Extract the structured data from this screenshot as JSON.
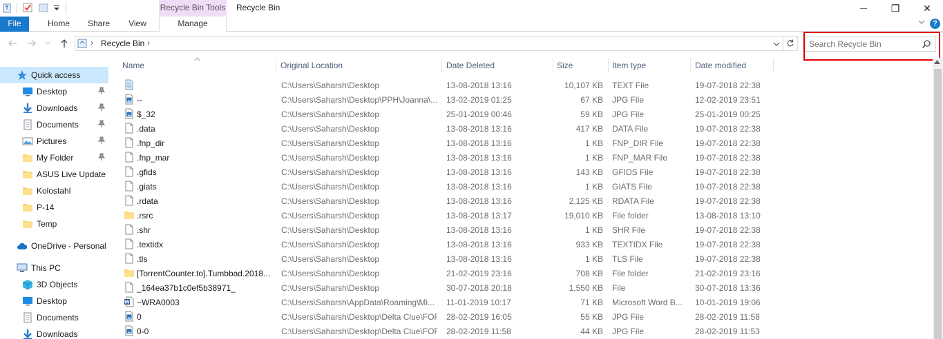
{
  "window": {
    "title": "Recycle Bin",
    "contextual_tab_group": "Recycle Bin Tools",
    "controls": {
      "minimize": "—",
      "maximize": "❐",
      "close": "✕"
    }
  },
  "ribbon": {
    "tabs": [
      "File",
      "Home",
      "Share",
      "View",
      "Manage"
    ],
    "help": "?"
  },
  "address": {
    "breadcrumb_separator": "›",
    "location": "Recycle Bin",
    "trailing_chevron": "›"
  },
  "search": {
    "placeholder": "Search Recycle Bin"
  },
  "nav": {
    "items": [
      {
        "label": "Quick access",
        "icon": "star-icon",
        "pinned": false
      },
      {
        "label": "Desktop",
        "icon": "desktop-icon",
        "pinned": true
      },
      {
        "label": "Downloads",
        "icon": "download-icon",
        "pinned": true
      },
      {
        "label": "Documents",
        "icon": "documents-icon",
        "pinned": true
      },
      {
        "label": "Pictures",
        "icon": "pictures-icon",
        "pinned": true
      },
      {
        "label": "My Folder",
        "icon": "folder-icon",
        "pinned": true
      },
      {
        "label": "ASUS Live Update",
        "icon": "folder-icon",
        "pinned": false
      },
      {
        "label": "Kolostahl",
        "icon": "folder-icon",
        "pinned": false
      },
      {
        "label": "P-14",
        "icon": "folder-icon",
        "pinned": false
      },
      {
        "label": "Temp",
        "icon": "folder-icon",
        "pinned": false
      },
      {
        "label": "OneDrive - Personal",
        "icon": "cloud-icon",
        "pinned": false
      },
      {
        "label": "This PC",
        "icon": "computer-icon",
        "pinned": false
      },
      {
        "label": "3D Objects",
        "icon": "cube-icon",
        "pinned": false
      },
      {
        "label": "Desktop",
        "icon": "desktop-icon",
        "pinned": false
      },
      {
        "label": "Documents",
        "icon": "documents-icon",
        "pinned": false
      },
      {
        "label": "Downloads",
        "icon": "download-icon",
        "pinned": false
      }
    ]
  },
  "columns": {
    "name": "Name",
    "original_location": "Original Location",
    "date_deleted": "Date Deleted",
    "size": "Size",
    "item_type": "Item type",
    "date_modified": "Date modified"
  },
  "files": [
    {
      "name": "",
      "icon": "text-file-icon",
      "location": "C:\\Users\\Saharsh\\Desktop",
      "deleted": "13-08-2018 13:16",
      "size": "10,107 KB",
      "type": "TEXT File",
      "modified": "19-07-2018 22:38"
    },
    {
      "name": "--",
      "icon": "image-file-icon",
      "location": "C:\\Users\\Saharsh\\Desktop\\PPH\\Joanna\\...",
      "deleted": "13-02-2019 01:25",
      "size": "67 KB",
      "type": "JPG File",
      "modified": "12-02-2019 23:51"
    },
    {
      "name": "$_32",
      "icon": "image-file-icon",
      "location": "C:\\Users\\Saharsh\\Desktop",
      "deleted": "25-01-2019 00:46",
      "size": "59 KB",
      "type": "JPG File",
      "modified": "25-01-2019 00:25"
    },
    {
      "name": ".data",
      "icon": "blank-file-icon",
      "location": "C:\\Users\\Saharsh\\Desktop",
      "deleted": "13-08-2018 13:16",
      "size": "417 KB",
      "type": "DATA File",
      "modified": "19-07-2018 22:38"
    },
    {
      "name": ".fnp_dir",
      "icon": "blank-file-icon",
      "location": "C:\\Users\\Saharsh\\Desktop",
      "deleted": "13-08-2018 13:16",
      "size": "1 KB",
      "type": "FNP_DIR File",
      "modified": "19-07-2018 22:38"
    },
    {
      "name": ".fnp_mar",
      "icon": "blank-file-icon",
      "location": "C:\\Users\\Saharsh\\Desktop",
      "deleted": "13-08-2018 13:16",
      "size": "1 KB",
      "type": "FNP_MAR File",
      "modified": "19-07-2018 22:38"
    },
    {
      "name": ".gfids",
      "icon": "blank-file-icon",
      "location": "C:\\Users\\Saharsh\\Desktop",
      "deleted": "13-08-2018 13:16",
      "size": "143 KB",
      "type": "GFIDS File",
      "modified": "19-07-2018 22:38"
    },
    {
      "name": ".giats",
      "icon": "blank-file-icon",
      "location": "C:\\Users\\Saharsh\\Desktop",
      "deleted": "13-08-2018 13:16",
      "size": "1 KB",
      "type": "GIATS File",
      "modified": "19-07-2018 22:38"
    },
    {
      "name": ".rdata",
      "icon": "blank-file-icon",
      "location": "C:\\Users\\Saharsh\\Desktop",
      "deleted": "13-08-2018 13:16",
      "size": "2,125 KB",
      "type": "RDATA File",
      "modified": "19-07-2018 22:38"
    },
    {
      "name": ".rsrc",
      "icon": "folder-icon",
      "location": "C:\\Users\\Saharsh\\Desktop",
      "deleted": "13-08-2018 13:17",
      "size": "19,010 KB",
      "type": "File folder",
      "modified": "13-08-2018 13:10"
    },
    {
      "name": ".shr",
      "icon": "blank-file-icon",
      "location": "C:\\Users\\Saharsh\\Desktop",
      "deleted": "13-08-2018 13:16",
      "size": "1 KB",
      "type": "SHR File",
      "modified": "19-07-2018 22:38"
    },
    {
      "name": ".textidx",
      "icon": "blank-file-icon",
      "location": "C:\\Users\\Saharsh\\Desktop",
      "deleted": "13-08-2018 13:16",
      "size": "933 KB",
      "type": "TEXTIDX File",
      "modified": "19-07-2018 22:38"
    },
    {
      "name": ".tls",
      "icon": "blank-file-icon",
      "location": "C:\\Users\\Saharsh\\Desktop",
      "deleted": "13-08-2018 13:16",
      "size": "1 KB",
      "type": "TLS File",
      "modified": "19-07-2018 22:38"
    },
    {
      "name": "[TorrentCounter.to].Tumbbad.2018...",
      "icon": "folder-icon",
      "location": "C:\\Users\\Saharsh\\Desktop",
      "deleted": "21-02-2019 23:16",
      "size": "708 KB",
      "type": "File folder",
      "modified": "21-02-2019 23:16"
    },
    {
      "name": "_164ea37b1c0ef5b38971_",
      "icon": "blank-file-icon",
      "location": "C:\\Users\\Saharsh\\Desktop",
      "deleted": "30-07-2018 20:18",
      "size": "1,550 KB",
      "type": "File",
      "modified": "30-07-2018 13:36"
    },
    {
      "name": "~WRA0003",
      "icon": "word-file-icon",
      "location": "C:\\Users\\Saharsh\\AppData\\Roaming\\Mi...",
      "deleted": "11-01-2019 10:17",
      "size": "71 KB",
      "type": "Microsoft Word B...",
      "modified": "10-01-2019 19:06"
    },
    {
      "name": "0",
      "icon": "image-file-icon",
      "location": "C:\\Users\\Saharsh\\Desktop\\Delta Clue\\FOF",
      "deleted": "28-02-2019 16:05",
      "size": "55 KB",
      "type": "JPG File",
      "modified": "28-02-2019 11:58"
    },
    {
      "name": "0-0",
      "icon": "image-file-icon",
      "location": "C:\\Users\\Saharsh\\Desktop\\Delta Clue\\FOF",
      "deleted": "28-02-2019 11:58",
      "size": "44 KB",
      "type": "JPG File",
      "modified": "28-02-2019 11:53"
    }
  ]
}
